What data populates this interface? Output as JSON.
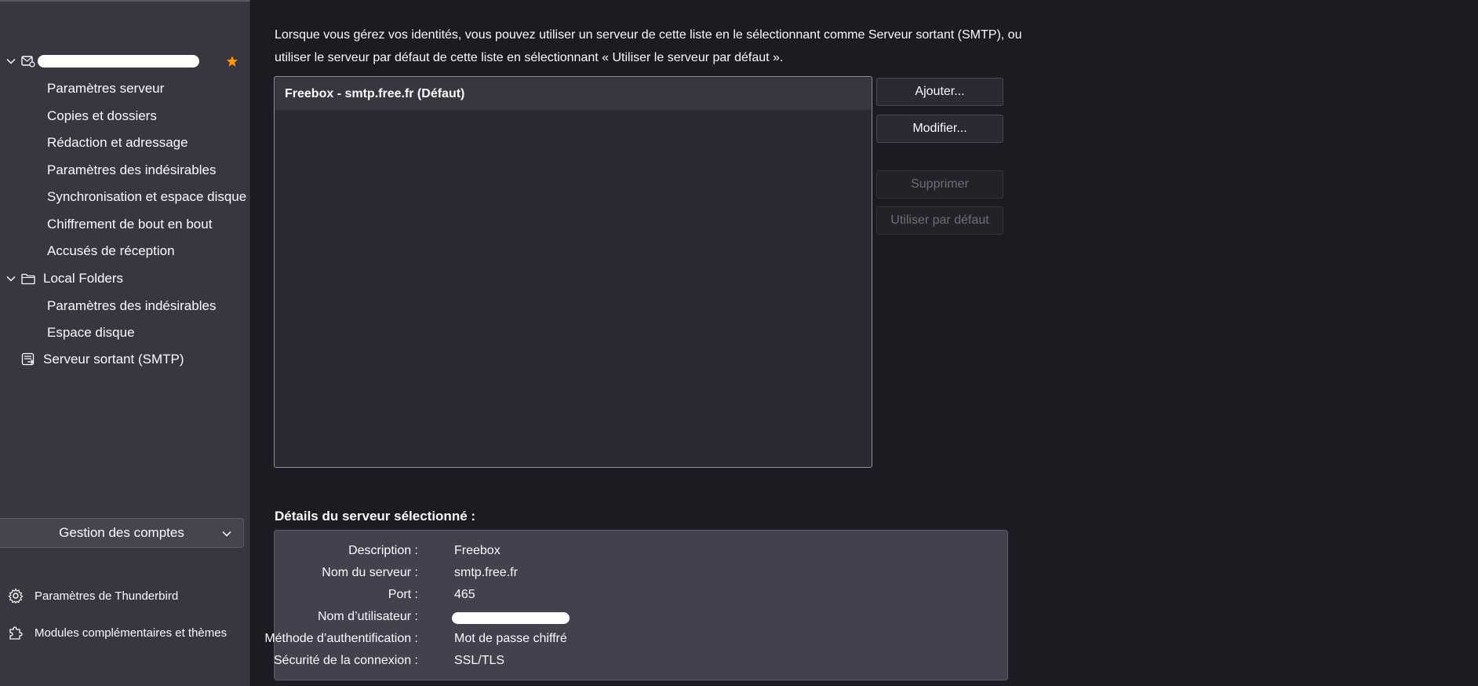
{
  "sidebar": {
    "account": {
      "label": ""
    },
    "account_children": [
      "Paramètres serveur",
      "Copies et dossiers",
      "Rédaction et adressage",
      "Paramètres des indésirables",
      "Synchronisation et espace disque",
      "Chiffrement de bout en bout",
      "Accusés de réception"
    ],
    "local_folders": {
      "label": "Local Folders",
      "children": [
        "Paramètres des indésirables",
        "Espace disque"
      ]
    },
    "smtp": {
      "label": "Serveur sortant (SMTP)"
    },
    "account_menu": {
      "label": "Gestion des comptes"
    },
    "footer": {
      "settings": "Paramètres de Thunderbird",
      "addons": "Modules complémentaires et thèmes"
    }
  },
  "main": {
    "intro": "Lorsque vous gérez vos identités, vous pouvez utiliser un serveur de cette liste en le sélectionnant comme Serveur sortant (SMTP), ou utiliser le serveur par défaut de cette liste en sélectionnant « Utiliser le serveur par défaut ».",
    "servers": [
      "Freebox - smtp.free.fr (Défaut)"
    ],
    "buttons": {
      "add": "Ajouter...",
      "edit": "Modifier...",
      "remove": "Supprimer",
      "set_default": "Utiliser par défaut"
    },
    "details": {
      "title": "Détails du serveur sélectionné :",
      "rows": [
        {
          "label": "Description :",
          "value": "Freebox"
        },
        {
          "label": "Nom du serveur :",
          "value": "smtp.free.fr"
        },
        {
          "label": "Port :",
          "value": "465"
        },
        {
          "label": "Nom d’utilisateur :",
          "value": ""
        },
        {
          "label": "Méthode d’authentification :",
          "value": "Mot de passe chiffré"
        },
        {
          "label": "Sécurité de la connexion :",
          "value": "SSL/TLS"
        }
      ]
    }
  },
  "colors": {
    "accent_star": "#ff9500",
    "sidebar_bg": "#38373f",
    "main_bg": "#1c1b22"
  }
}
